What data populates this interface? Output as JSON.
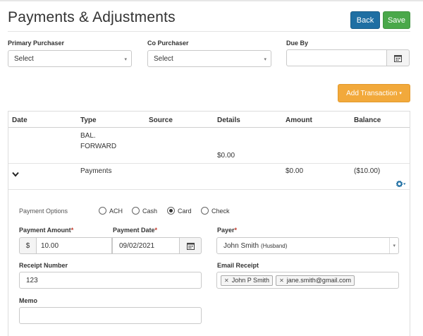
{
  "page": {
    "title": "Payments & Adjustments",
    "back_label": "Back",
    "save_label": "Save"
  },
  "filters": {
    "primary_purchaser_label": "Primary Purchaser",
    "primary_purchaser_value": "Select",
    "co_purchaser_label": "Co Purchaser",
    "co_purchaser_value": "Select",
    "due_by_label": "Due By",
    "due_by_value": ""
  },
  "add_transaction_label": "Add Transaction",
  "table": {
    "headers": [
      "Date",
      "Type",
      "Source",
      "Details",
      "Amount",
      "Balance"
    ],
    "bal_forward": {
      "type_line1": "BAL.",
      "type_line2": "FORWARD",
      "details": "$0.00"
    },
    "payments_row": {
      "type": "Payments",
      "amount": "$0.00",
      "balance": "($10.00)"
    }
  },
  "payment_form": {
    "options_label": "Payment Options",
    "options": [
      "ACH",
      "Cash",
      "Card",
      "Check"
    ],
    "selected_option": "Card",
    "amount_label": "Payment Amount",
    "currency_symbol": "$",
    "amount_value": "10.00",
    "date_label": "Payment Date",
    "date_value": "09/02/2021",
    "payer_label": "Payer",
    "payer_name": "John Smith",
    "payer_relation": "(Husband)",
    "receipt_number_label": "Receipt Number",
    "receipt_number_value": "123",
    "email_receipt_label": "Email Receipt",
    "email_tags": [
      "John P Smith",
      "jane.smith@gmail.com"
    ],
    "memo_label": "Memo",
    "memo_value": "",
    "required_mark": "*"
  },
  "colors": {
    "back": "#1f6fa3",
    "save": "#4aa84a",
    "add_transaction": "#f2a93b",
    "gear": "#1f6fa3"
  }
}
